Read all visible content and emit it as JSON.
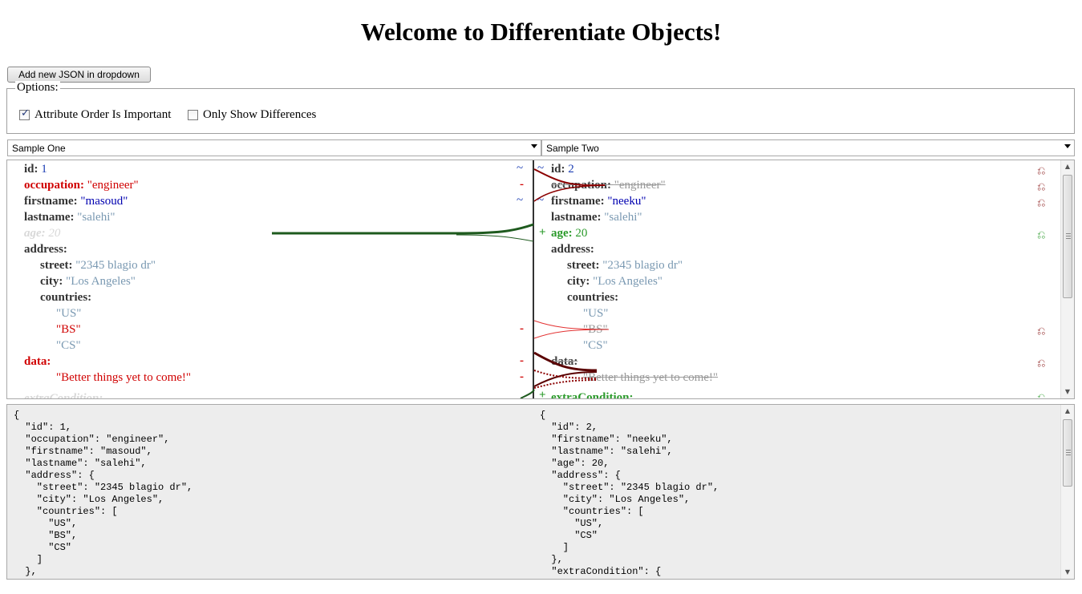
{
  "page": {
    "title": "Welcome to Differentiate Objects!"
  },
  "toolbar": {
    "add_json_label": "Add new JSON in dropdown"
  },
  "options": {
    "legend": "Options:",
    "attribute_order": {
      "label": "Attribute Order Is Important",
      "checked": true
    },
    "only_differences": {
      "label": "Only Show Differences",
      "checked": false
    }
  },
  "selectors": {
    "left": {
      "selected": "Sample One"
    },
    "right": {
      "selected": "Sample Two"
    }
  },
  "diff": {
    "left": {
      "id_key": "id:",
      "id_val": "1",
      "occupation_key": "occupation:",
      "occupation_val": "\"engineer\"",
      "firstname_key": "firstname:",
      "firstname_val": "\"masoud\"",
      "lastname_key": "lastname:",
      "lastname_val": "\"salehi\"",
      "age_key": "age:",
      "age_val": "20",
      "address_key": "address:",
      "street_key": "street:",
      "street_val": "\"2345 blagio dr\"",
      "city_key": "city:",
      "city_val": "\"Los Angeles\"",
      "countries_key": "countries:",
      "c1": "\"US\"",
      "c2": "\"BS\"",
      "c3": "\"CS\"",
      "data_key": "data:",
      "data_val": "\"Better things yet to come!\"",
      "extra_key": "extraCondition:"
    },
    "right": {
      "id_key": "id:",
      "id_val": "2",
      "occupation_key": "occupation:",
      "occupation_val": "\"engineer\"",
      "firstname_key": "firstname:",
      "firstname_val": "\"neeku\"",
      "lastname_key": "lastname:",
      "lastname_val": "\"salehi\"",
      "age_key": "age:",
      "age_val": "20",
      "address_key": "address:",
      "street_key": "street:",
      "street_val": "\"2345 blagio dr\"",
      "city_key": "city:",
      "city_val": "\"Los Angeles\"",
      "countries_key": "countries:",
      "c1": "\"US\"",
      "c2": "\"BS\"",
      "c3": "\"CS\"",
      "data_key": "data:",
      "data_val": "\"Better things yet to come!\"",
      "extra_key": "extraCondition:"
    },
    "markers": {
      "tilde": "~",
      "minus": "-",
      "plus": "+",
      "revert": "⎌"
    }
  },
  "json": {
    "left": "{\n  \"id\": 1,\n  \"occupation\": \"engineer\",\n  \"firstname\": \"masoud\",\n  \"lastname\": \"salehi\",\n  \"address\": {\n    \"street\": \"2345 blagio dr\",\n    \"city\": \"Los Angeles\",\n    \"countries\": [\n      \"US\",\n      \"BS\",\n      \"CS\"\n    ]\n  },",
    "right": "{\n  \"id\": 2,\n  \"firstname\": \"neeku\",\n  \"lastname\": \"salehi\",\n  \"age\": 20,\n  \"address\": {\n    \"street\": \"2345 blagio dr\",\n    \"city\": \"Los Angeles\",\n    \"countries\": [\n      \"US\",\n      \"CS\"\n    ]\n  },\n  \"extraCondition\": {"
  },
  "colors": {
    "removed": "#d00000",
    "added": "#2a9a2a",
    "changed": "#1d3fb4",
    "value": "#7a99b2",
    "connector_removed": "#8b0000",
    "connector_added": "#1e5a1e"
  }
}
